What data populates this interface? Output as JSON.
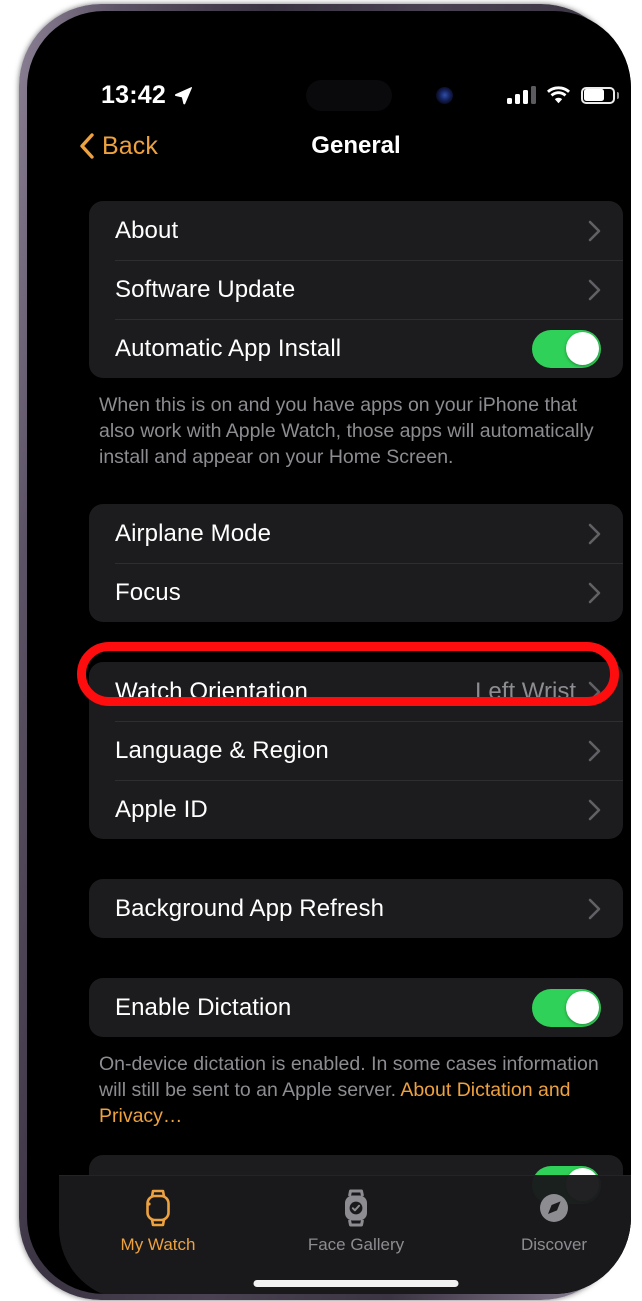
{
  "status_bar": {
    "time": "13:42",
    "location_icon": "location-arrow-icon",
    "cellular_icon": "cellular-signal-icon",
    "wifi_icon": "wifi-icon",
    "battery_icon": "battery-icon"
  },
  "nav": {
    "back_label": "Back",
    "back_icon": "chevron-left-icon",
    "title": "General"
  },
  "groups": [
    {
      "rows": [
        {
          "label": "About",
          "type": "disclosure"
        },
        {
          "label": "Software Update",
          "type": "disclosure"
        },
        {
          "label": "Automatic App Install",
          "type": "toggle",
          "toggle_on": true
        }
      ],
      "footnote": "When this is on and you have apps on your iPhone that also work with Apple Watch, those apps will automatically install and appear on your Home Screen."
    },
    {
      "rows": [
        {
          "label": "Airplane Mode",
          "type": "disclosure"
        },
        {
          "label": "Focus",
          "type": "disclosure"
        }
      ]
    },
    {
      "rows": [
        {
          "label": "Watch Orientation",
          "type": "value",
          "value": "Left Wrist"
        },
        {
          "label": "Language & Region",
          "type": "disclosure"
        },
        {
          "label": "Apple ID",
          "type": "disclosure",
          "highlighted": true
        }
      ]
    },
    {
      "rows": [
        {
          "label": "Background App Refresh",
          "type": "disclosure"
        }
      ]
    },
    {
      "rows": [
        {
          "label": "Enable Dictation",
          "type": "toggle",
          "toggle_on": true
        }
      ],
      "footnote": "On-device dictation is enabled. In some cases information will still be sent to an Apple server. ",
      "footnote_link": "About Dictation and Privacy…"
    }
  ],
  "tab_bar": {
    "tabs": [
      {
        "label": "My Watch",
        "icon": "watch-outline-icon",
        "active": true
      },
      {
        "label": "Face Gallery",
        "icon": "watch-face-icon",
        "active": false
      },
      {
        "label": "Discover",
        "icon": "compass-icon",
        "active": false
      }
    ]
  },
  "annotation": {
    "shape": "rounded-rect-outline",
    "color": "#fd0d0d",
    "target": "Apple ID"
  },
  "colors": {
    "accent": "#eda13f",
    "toggle_on": "#30d158",
    "card": "#1c1c1e",
    "background": "#000000",
    "secondary_text": "#8c8c91",
    "annotation": "#fd0d0d"
  }
}
